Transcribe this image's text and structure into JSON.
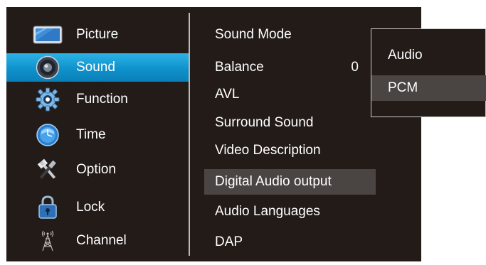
{
  "left_menu": {
    "items": [
      {
        "label": "Picture",
        "icon": "picture-icon"
      },
      {
        "label": "Sound",
        "icon": "speaker-icon",
        "selected": true
      },
      {
        "label": "Function",
        "icon": "gear-icon"
      },
      {
        "label": "Time",
        "icon": "clock-icon"
      },
      {
        "label": "Option",
        "icon": "tools-icon"
      },
      {
        "label": "Lock",
        "icon": "lock-icon"
      },
      {
        "label": "Channel",
        "icon": "antenna-icon"
      }
    ]
  },
  "sound_menu": {
    "items": [
      {
        "label": "Sound Mode"
      },
      {
        "label": "Balance",
        "value": "0"
      },
      {
        "label": "AVL"
      },
      {
        "label": "Surround Sound"
      },
      {
        "label": "Video Description"
      },
      {
        "label": "Digital Audio output",
        "highlighted": true
      },
      {
        "label": "Audio Languages"
      },
      {
        "label": "DAP"
      }
    ]
  },
  "digital_audio_popup": {
    "options": [
      {
        "label": "Audio"
      },
      {
        "label": "PCM",
        "selected": true
      }
    ]
  },
  "colors": {
    "background": "#221b18",
    "selected_blue": "#1a9fd6",
    "highlight_gray": "#4a4542",
    "text": "#ffffff"
  }
}
